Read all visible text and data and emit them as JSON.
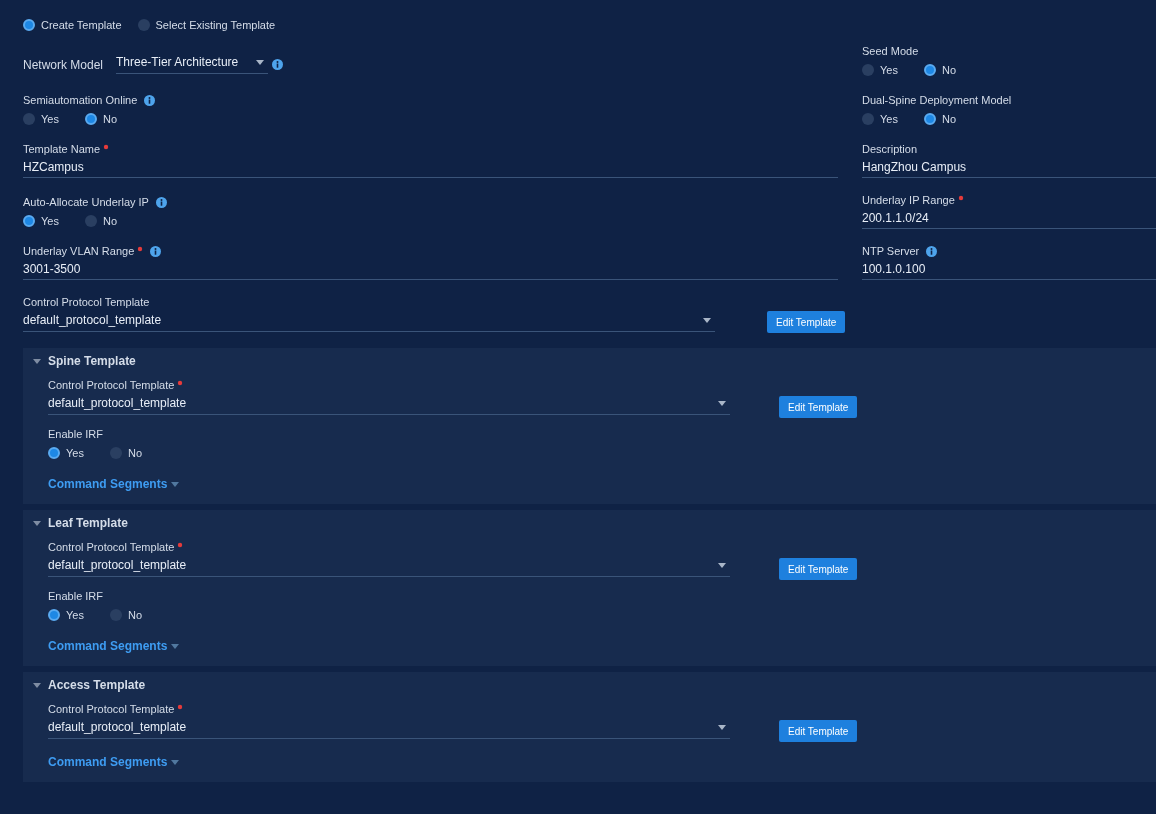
{
  "template_source": [
    {
      "label": "Create Template",
      "selected": true
    },
    {
      "label": "Select Existing Template",
      "selected": false
    }
  ],
  "rows": [
    {
      "left": {
        "kind": "inline_select",
        "label": "Network Model",
        "value": "Three-Tier Architecture",
        "info": true
      },
      "right": {
        "kind": "radio",
        "label": "Seed Mode",
        "options": [
          {
            "label": "Yes",
            "selected": false
          },
          {
            "label": "No",
            "selected": true
          }
        ]
      }
    },
    {
      "left": {
        "kind": "radio",
        "label": "Semiautomation Online",
        "info": true,
        "options": [
          {
            "label": "Yes",
            "selected": false
          },
          {
            "label": "No",
            "selected": true
          }
        ]
      },
      "right": {
        "kind": "radio",
        "label": "Dual-Spine Deployment Model",
        "options": [
          {
            "label": "Yes",
            "selected": false
          },
          {
            "label": "No",
            "selected": true
          }
        ]
      }
    },
    {
      "left": {
        "kind": "text",
        "label": "Template Name",
        "required": true,
        "value": "HZCampus"
      },
      "right": {
        "kind": "text",
        "label": "Description",
        "value": "HangZhou Campus"
      }
    },
    {
      "left": {
        "kind": "radio",
        "label": "Auto-Allocate Underlay IP",
        "info": true,
        "options": [
          {
            "label": "Yes",
            "selected": true
          },
          {
            "label": "No",
            "selected": false
          }
        ]
      },
      "right": {
        "kind": "text",
        "label": "Underlay IP Range",
        "required": true,
        "value": "200.1.1.0/24"
      }
    },
    {
      "left": {
        "kind": "text",
        "label": "Underlay VLAN Range",
        "required": true,
        "info": true,
        "value": "3001-3500"
      },
      "right": {
        "kind": "text",
        "label": "NTP Server",
        "info": true,
        "value": "100.1.0.100"
      }
    }
  ],
  "control_protocol": {
    "label": "Control Protocol Template",
    "value": "default_protocol_template",
    "button": "Edit Template"
  },
  "sections": [
    {
      "title": "Spine Template",
      "expanded": true,
      "protocol": {
        "label": "Control Protocol Template",
        "required": true,
        "value": "default_protocol_template"
      },
      "button": "Edit Template",
      "irf": {
        "label": "Enable IRF",
        "options": [
          {
            "label": "Yes",
            "selected": true
          },
          {
            "label": "No",
            "selected": false
          }
        ]
      },
      "command_segments": "Command Segments"
    },
    {
      "title": "Leaf Template",
      "expanded": true,
      "protocol": {
        "label": "Control Protocol Template",
        "required": true,
        "value": "default_protocol_template"
      },
      "button": "Edit Template",
      "irf": {
        "label": "Enable IRF",
        "options": [
          {
            "label": "Yes",
            "selected": true
          },
          {
            "label": "No",
            "selected": false
          }
        ]
      },
      "command_segments": "Command Segments"
    },
    {
      "title": "Access Template",
      "expanded": true,
      "protocol": {
        "label": "Control Protocol Template",
        "required": true,
        "value": "default_protocol_template"
      },
      "button": "Edit Template",
      "command_segments": "Command Segments"
    }
  ]
}
